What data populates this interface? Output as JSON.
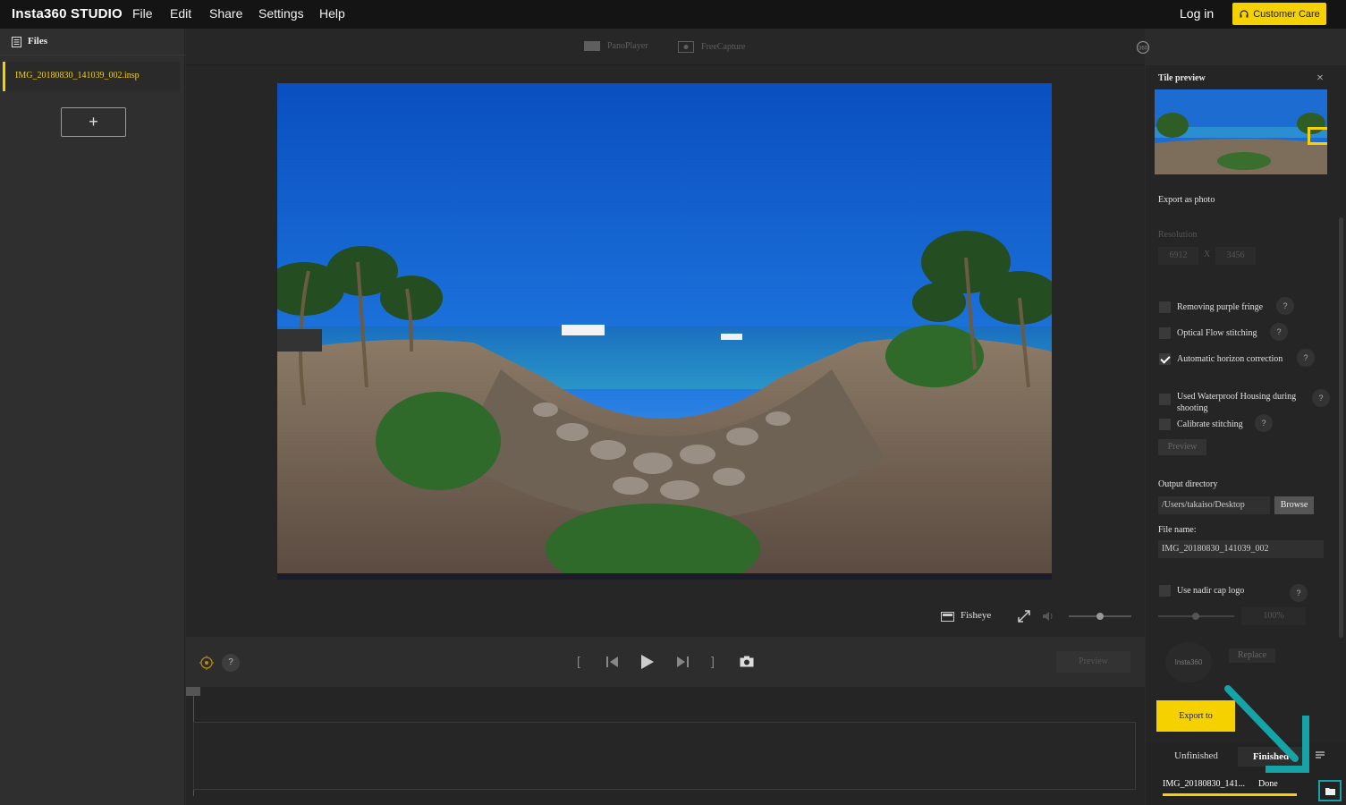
{
  "app": {
    "logo": "Insta360 STUDIO",
    "menu": [
      "File",
      "Edit",
      "Share",
      "Settings",
      "Help"
    ],
    "login": "Log in",
    "customer_care": "Customer Care"
  },
  "sidebar": {
    "title": "Files",
    "file_name": "IMG_20180830_141039_002.insp",
    "add_label": "+"
  },
  "viewer": {
    "modes": [
      "PanoPlayer",
      "FreeCapture"
    ],
    "view_mode": "Fisheye",
    "transport": {
      "mark_in": "[",
      "mark_out": "]",
      "preview": "Preview",
      "help": "?"
    }
  },
  "panel": {
    "tile_preview_title": "Tile preview",
    "close": "×",
    "export_as_photo": "Export as photo",
    "resolution_label": "Resolution",
    "res_width": "6912",
    "res_x": "X",
    "res_height": "3456",
    "options": [
      {
        "label": "Removing purple fringe",
        "checked": false
      },
      {
        "label": "Optical Flow stitching",
        "checked": false
      },
      {
        "label": "Automatic horizon correction",
        "checked": true
      },
      {
        "label": "Used Waterproof Housing during shooting",
        "checked": false
      },
      {
        "label": "Calibrate stitching",
        "checked": false
      }
    ],
    "help": "?",
    "preview_btn": "Preview",
    "output_dir_label": "Output directory",
    "output_dir_value": "/Users/takaiso/Desktop",
    "browse": "Browse",
    "file_name_label": "File name:",
    "file_name_value": "IMG_20180830_141039_002",
    "nadir_label": "Use nadir cap logo",
    "nadir_percent": "100%",
    "nadir_logo_text": "Insta360",
    "replace": "Replace",
    "export_to": "Export to",
    "tab_unfinished": "Unfinished",
    "tab_finished": "Finished",
    "job_name": "IMG_20180830_141...",
    "job_status": "Done",
    "job_progress": 1.0
  },
  "colors": {
    "accent": "#f5d100",
    "annotation": "#16a3a8"
  }
}
